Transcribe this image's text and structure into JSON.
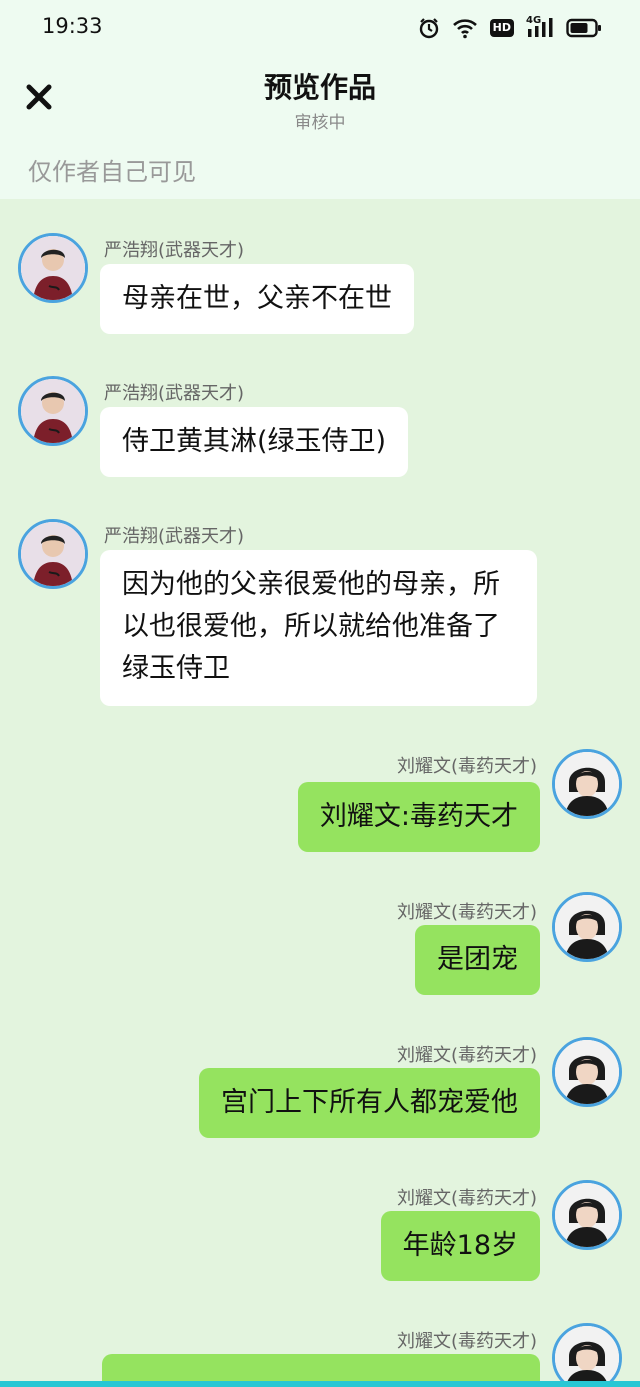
{
  "status_bar": {
    "time": "19:33",
    "hd": "HD",
    "network": "4G"
  },
  "nav": {
    "title": "预览作品",
    "subtitle": "审核中"
  },
  "visibility_note": "仅作者自己可见",
  "messages": [
    {
      "side": "left",
      "sender": "严浩翔(武器天才)",
      "text": "母亲在世，父亲不在世"
    },
    {
      "side": "left",
      "sender": "严浩翔(武器天才)",
      "text": "侍卫黄其淋(绿玉侍卫)"
    },
    {
      "side": "left",
      "sender": "严浩翔(武器天才)",
      "text": "因为他的父亲很爱他的母亲，所以也很爱他，所以就给他准备了绿玉侍卫"
    },
    {
      "side": "right",
      "sender": "刘耀文(毒药天才)",
      "text": "刘耀文:毒药天才"
    },
    {
      "side": "right",
      "sender": "刘耀文(毒药天才)",
      "text": "是团宠"
    },
    {
      "side": "right",
      "sender": "刘耀文(毒药天才)",
      "text": "宫门上下所有人都宠爱他"
    },
    {
      "side": "right",
      "sender": "刘耀文(毒药天才)",
      "text": "年龄18岁"
    },
    {
      "side": "right",
      "sender": "刘耀文(毒药天才)",
      "text": ""
    }
  ],
  "colors": {
    "chat_background": "#e3f4de",
    "header_background": "#eefbf1",
    "bubble_left": "#ffffff",
    "bubble_right": "#95e35f",
    "avatar_ring": "#4aa3df"
  }
}
